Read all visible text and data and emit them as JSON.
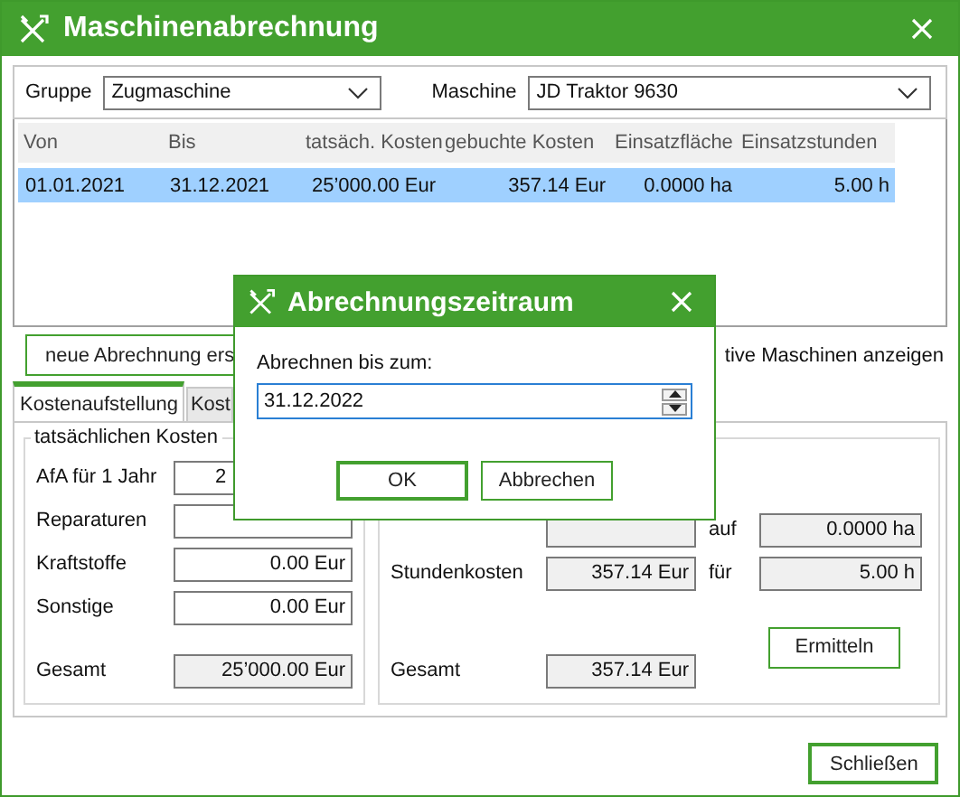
{
  "window": {
    "title": "Maschinenabrechnung"
  },
  "filters": {
    "group_label": "Gruppe",
    "group_value": "Zugmaschine",
    "machine_label": "Maschine",
    "machine_value": "JD Traktor 9630"
  },
  "table": {
    "columns": [
      "Von",
      "Bis",
      "tatsäch. Kosten",
      "gebuchte Kosten",
      "Einsatzfläche",
      "Einsatzstunden"
    ],
    "rows": [
      {
        "cells": [
          "01.01.2021",
          "31.12.2021",
          "25’000.00 Eur",
          "357.14 Eur",
          "0.0000 ha",
          "5.00 h"
        ],
        "selected": true
      }
    ]
  },
  "new_button": "neue Abrechnung ers",
  "inactive_label": "tive Maschinen anzeigen",
  "tabs": [
    {
      "label": "Kostenaufstellung",
      "selected": true
    },
    {
      "label": "Kost",
      "selected": false
    }
  ],
  "actual_costs": {
    "title": "tatsächlichen Kosten",
    "rows": [
      {
        "label": "AfA für 1 Jahr",
        "value": "2"
      },
      {
        "label": "Reparaturen"
      },
      {
        "label": "Kraftstoffe",
        "value": "0.00 Eur"
      },
      {
        "label": "Sonstige",
        "value": "0.00 Eur"
      }
    ],
    "total_label": "Gesamt",
    "total_value": "25’000.00 Eur"
  },
  "booked_costs": {
    "rows": [
      {
        "unit_label": "auf",
        "amount": "0.0000 ha"
      },
      {
        "label": "Stundenkosten",
        "value": "357.14 Eur",
        "unit_label": "für",
        "amount": "5.00 h"
      }
    ],
    "total_label": "Gesamt",
    "total_value": "357.14 Eur",
    "button": "Ermitteln"
  },
  "close_button": "Schließen",
  "dialog": {
    "title": "Abrechnungszeitraum",
    "label": "Abrechnen bis zum:",
    "value": "31.12.2022",
    "buttons": [
      {
        "label": "OK",
        "default": true
      },
      {
        "label": "Abbrechen",
        "default": false
      }
    ]
  }
}
